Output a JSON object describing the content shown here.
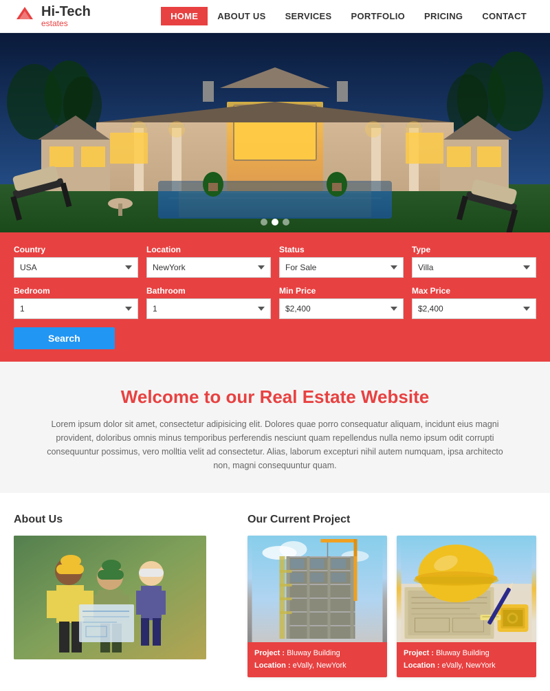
{
  "header": {
    "logo_title": "Hi-Tech",
    "logo_sub": "estates",
    "nav": [
      {
        "label": "HOME",
        "active": true
      },
      {
        "label": "ABOUT US",
        "active": false
      },
      {
        "label": "SERVICES",
        "active": false
      },
      {
        "label": "PORTFOLIO",
        "active": false
      },
      {
        "label": "PRICING",
        "active": false
      },
      {
        "label": "CONTACT",
        "active": false
      }
    ]
  },
  "hero": {
    "dots": 3,
    "active_dot": 1
  },
  "search": {
    "country_label": "Country",
    "country_value": "USA",
    "location_label": "Location",
    "location_value": "NewYork",
    "status_label": "Status",
    "status_value": "For Sale",
    "type_label": "Type",
    "type_value": "Villa",
    "bedroom_label": "Bedroom",
    "bedroom_value": "1",
    "bathroom_label": "Bathroom",
    "bathroom_value": "1",
    "min_price_label": "Min Price",
    "min_price_value": "$2,400",
    "max_price_label": "Max Price",
    "max_price_value": "$2,400",
    "search_button": "Search"
  },
  "welcome": {
    "title": "Welcome to our Real Estate Website",
    "body": "Lorem ipsum dolor sit amet, consectetur adipisicing elit. Dolores quae porro consequatur aliquam, incidunt eius magni provident, doloribus omnis minus temporibus perferendis nesciunt quam repellendus nulla nemo ipsum odit corrupti consequuntur possimus, vero molltia velit ad consectetur. Alias, laborum excepturi nihil autem numquam, ipsa architecto non, magni consequuntur quam."
  },
  "about": {
    "title": "About Us"
  },
  "projects": {
    "title": "Our Current Project",
    "cards": [
      {
        "project_label": "Project :",
        "project_value": "Bluway Building",
        "location_label": "Location :",
        "location_value": "eVally, NewYork",
        "type": "building"
      },
      {
        "project_label": "Project :",
        "project_value": "Bluway Building",
        "location_label": "Location :",
        "location_value": "eVally, NewYork",
        "type": "helmet"
      }
    ]
  },
  "colors": {
    "accent": "#e84141",
    "nav_active": "#e84141",
    "search_bg": "#e84141",
    "search_btn": "#2196f3",
    "welcome_title": "#e84141"
  }
}
